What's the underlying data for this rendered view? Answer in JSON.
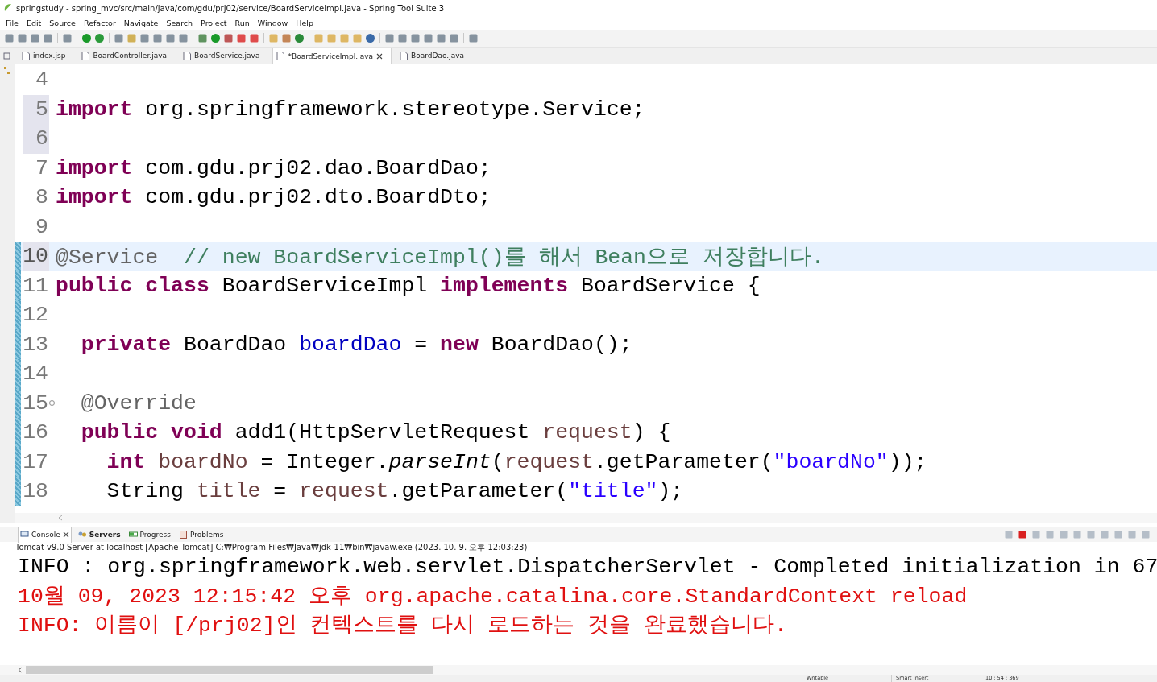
{
  "window": {
    "title": "springstudy - spring_mvc/src/main/java/com/gdu/prj02/service/BoardServiceImpl.java - Spring Tool Suite 3"
  },
  "menu": [
    "File",
    "Edit",
    "Source",
    "Refactor",
    "Navigate",
    "Search",
    "Project",
    "Run",
    "Window",
    "Help"
  ],
  "editor_tabs": [
    {
      "label": "index.jsp",
      "selected": false,
      "closable": false
    },
    {
      "label": "BoardController.java",
      "selected": false,
      "closable": false
    },
    {
      "label": "BoardService.java",
      "selected": false,
      "closable": false
    },
    {
      "label": "*BoardServiceImpl.java",
      "selected": true,
      "closable": true
    },
    {
      "label": "BoardDao.java",
      "selected": false,
      "closable": false
    }
  ],
  "code_lines": [
    {
      "number": "4",
      "current": false,
      "number_highlighted": false,
      "changed": false,
      "folding": false
    },
    {
      "number": "5",
      "current": false,
      "number_highlighted": true,
      "changed": false,
      "folding": false,
      "tokens": [
        {
          "text": "import",
          "kind": "keyword"
        },
        {
          "text": " org.springframework.stereotype.Service;",
          "kind": "plain"
        }
      ]
    },
    {
      "number": "6",
      "current": false,
      "number_highlighted": true,
      "changed": false,
      "folding": false
    },
    {
      "number": "7",
      "current": false,
      "number_highlighted": false,
      "changed": false,
      "folding": false,
      "tokens": [
        {
          "text": "import",
          "kind": "keyword"
        },
        {
          "text": " com.gdu.prj02.dao.BoardDao;",
          "kind": "plain"
        }
      ]
    },
    {
      "number": "8",
      "current": false,
      "number_highlighted": false,
      "changed": false,
      "folding": false,
      "tokens": [
        {
          "text": "import",
          "kind": "keyword"
        },
        {
          "text": " com.gdu.prj02.dto.BoardDto;",
          "kind": "plain"
        }
      ]
    },
    {
      "number": "9",
      "current": false,
      "number_highlighted": false,
      "changed": false,
      "folding": false
    },
    {
      "number": "10",
      "current": true,
      "number_highlighted": true,
      "changed": true,
      "folding": false,
      "tokens": [
        {
          "text": "@Service",
          "kind": "annotation"
        },
        {
          "text": "  // new BoardServiceImpl()를 해서 Bean으로 저장합니다.",
          "kind": "comment"
        }
      ]
    },
    {
      "number": "11",
      "current": false,
      "number_highlighted": false,
      "changed": true,
      "folding": false,
      "tokens": [
        {
          "text": "public class",
          "kind": "keyword"
        },
        {
          "text": " BoardServiceImpl ",
          "kind": "plain"
        },
        {
          "text": "implements",
          "kind": "keyword"
        },
        {
          "text": " BoardService {",
          "kind": "plain"
        }
      ]
    },
    {
      "number": "12",
      "current": false,
      "number_highlighted": false,
      "changed": true,
      "folding": false
    },
    {
      "number": "13",
      "current": false,
      "number_highlighted": false,
      "changed": true,
      "folding": false,
      "tokens": [
        {
          "text": "  private",
          "kind": "keyword"
        },
        {
          "text": " BoardDao ",
          "kind": "plain"
        },
        {
          "text": "boardDao",
          "kind": "field"
        },
        {
          "text": " = ",
          "kind": "plain"
        },
        {
          "text": "new",
          "kind": "keyword"
        },
        {
          "text": " BoardDao();",
          "kind": "plain"
        }
      ]
    },
    {
      "number": "14",
      "current": false,
      "number_highlighted": false,
      "changed": true,
      "folding": false
    },
    {
      "number": "15",
      "current": false,
      "number_highlighted": false,
      "changed": true,
      "folding": true,
      "tokens": [
        {
          "text": "  @Override",
          "kind": "annotation"
        }
      ]
    },
    {
      "number": "16",
      "current": false,
      "number_highlighted": false,
      "changed": true,
      "folding": false,
      "tokens": [
        {
          "text": "  public void",
          "kind": "keyword"
        },
        {
          "text": " add1(HttpServletRequest ",
          "kind": "plain"
        },
        {
          "text": "request",
          "kind": "variable"
        },
        {
          "text": ") {",
          "kind": "plain"
        }
      ]
    },
    {
      "number": "17",
      "current": false,
      "number_highlighted": false,
      "changed": true,
      "folding": false,
      "tokens": [
        {
          "text": "    int",
          "kind": "keyword"
        },
        {
          "text": " boardNo",
          "kind": "variable"
        },
        {
          "text": " = Integer.",
          "kind": "plain"
        },
        {
          "text": "parseInt",
          "kind": "static"
        },
        {
          "text": "(",
          "kind": "plain"
        },
        {
          "text": "request",
          "kind": "variable"
        },
        {
          "text": ".getParameter(",
          "kind": "plain"
        },
        {
          "text": "\"boardNo\"",
          "kind": "string"
        },
        {
          "text": "));",
          "kind": "plain"
        }
      ]
    },
    {
      "number": "18",
      "current": false,
      "number_highlighted": false,
      "changed": true,
      "folding": false,
      "tokens": [
        {
          "text": "    String ",
          "kind": "plain"
        },
        {
          "text": "title",
          "kind": "variable"
        },
        {
          "text": " = ",
          "kind": "plain"
        },
        {
          "text": "request",
          "kind": "variable"
        },
        {
          "text": ".getParameter(",
          "kind": "plain"
        },
        {
          "text": "\"title\"",
          "kind": "string"
        },
        {
          "text": ");",
          "kind": "plain"
        }
      ]
    }
  ],
  "console_tabs": [
    {
      "label": "Console",
      "selected": true,
      "closable": true,
      "kind": "console"
    },
    {
      "label": "Servers",
      "selected": false,
      "closable": false,
      "kind": "servers"
    },
    {
      "label": "Progress",
      "selected": false,
      "closable": false,
      "kind": "progress"
    },
    {
      "label": "Problems",
      "selected": false,
      "closable": false,
      "kind": "problems"
    }
  ],
  "console_description": "Tomcat v9.0 Server at localhost [Apache Tomcat] C:₩Program Files₩Java₩jdk-11₩bin₩javaw.exe  (2023. 10. 9. 오후 12:03:23)",
  "console_lines": [
    {
      "text": "INFO : org.springframework.web.servlet.DispatcherServlet - Completed initialization in 67",
      "kind": "stdout"
    },
    {
      "text": "10월 09, 2023 12:15:42 오후 org.apache.catalina.core.StandardContext reload",
      "kind": "stderr"
    },
    {
      "text": "INFO: 이름이 [/prj02]인 컨텍스트를 다시 로드하는 것을 완료했습니다.",
      "kind": "stderr"
    }
  ],
  "status_bar": [
    "Writable",
    "Smart Insert",
    "10 : 54 : 369"
  ]
}
